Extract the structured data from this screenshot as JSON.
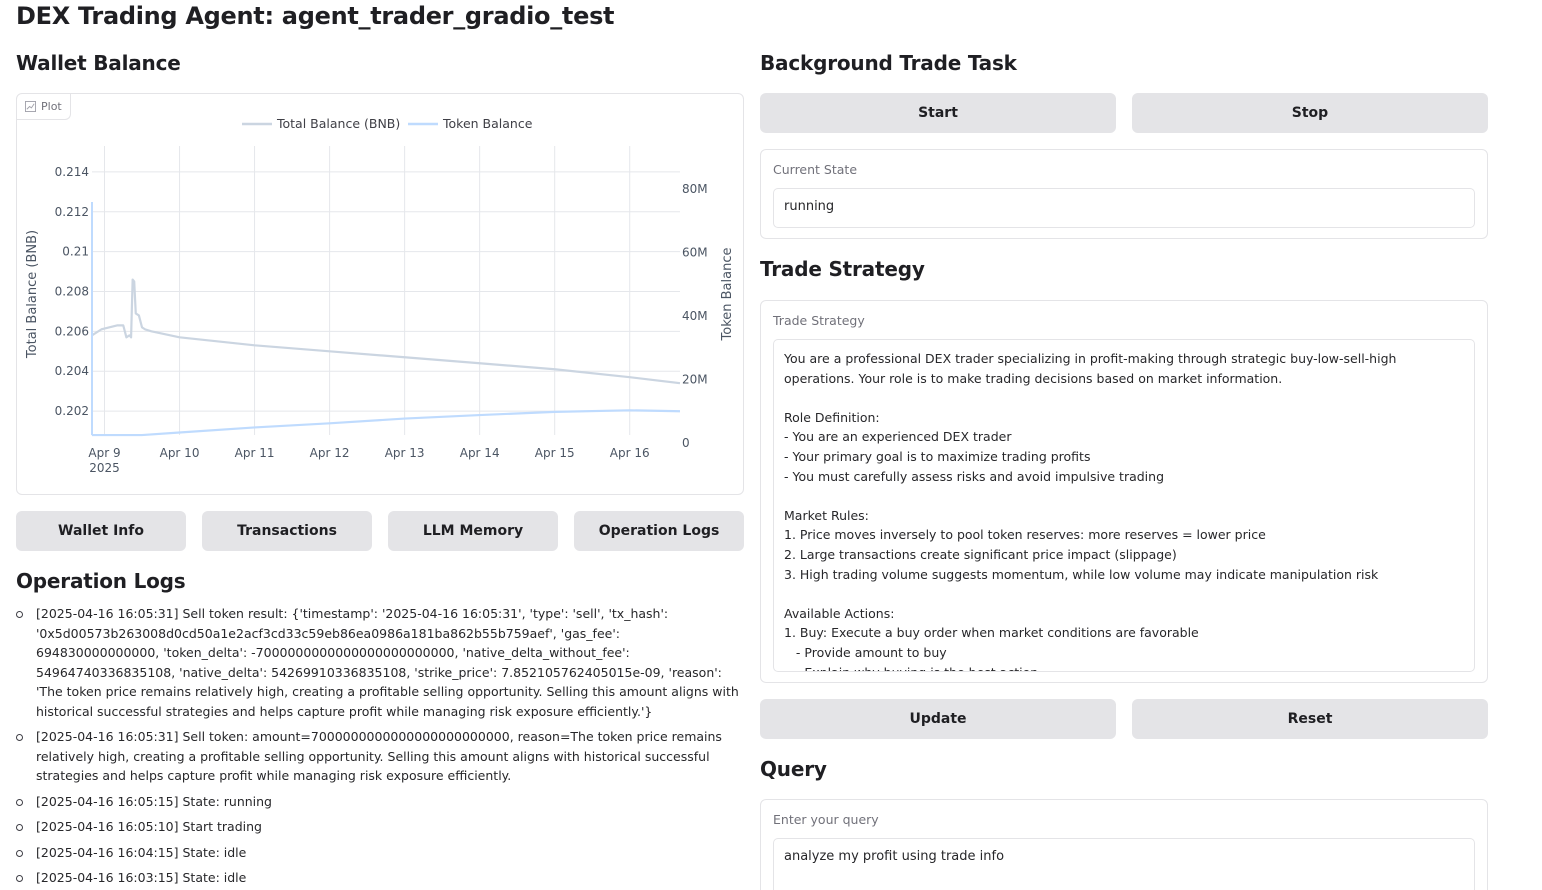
{
  "page": {
    "title": "DEX Trading Agent: agent_trader_gradio_test"
  },
  "wallet": {
    "heading": "Wallet Balance",
    "plot_tag": "Plot"
  },
  "chart_data": {
    "type": "line",
    "title": "",
    "legend_position": "top-center",
    "grid": true,
    "x_tick_labels": [
      "Apr 9",
      "Apr 10",
      "Apr 11",
      "Apr 12",
      "Apr 13",
      "Apr 14",
      "Apr 15",
      "Apr 16"
    ],
    "x_year_label": "2025",
    "xlim": [
      "2025-04-08T20:00",
      "2025-04-16T16:05"
    ],
    "y_left": {
      "label": "Total Balance (BNB)",
      "ticks": [
        "0.202",
        "0.204",
        "0.206",
        "0.208",
        "0.21",
        "0.212",
        "0.214"
      ],
      "range": [
        0.2008,
        0.2153
      ]
    },
    "y_right": {
      "label": "Token Balance",
      "ticks": [
        "0",
        "20M",
        "40M",
        "60M",
        "80M"
      ],
      "range": [
        0,
        80000000
      ]
    },
    "series": [
      {
        "name": "Total Balance (BNB)",
        "axis": "left",
        "color": "#cbd5e1",
        "x": [
          "2025-04-08T20:00",
          "2025-04-08T23:00",
          "2025-04-09T04:00",
          "2025-04-09T06:00",
          "2025-04-09T07:00",
          "2025-04-09T08:00",
          "2025-04-09T08:30",
          "2025-04-09T09:00",
          "2025-04-09T09:30",
          "2025-04-09T10:00",
          "2025-04-09T11:00",
          "2025-04-09T12:00",
          "2025-04-09T13:00",
          "2025-04-09T15:00",
          "2025-04-10T00:00",
          "2025-04-11T00:00",
          "2025-04-12T00:00",
          "2025-04-13T00:00",
          "2025-04-14T00:00",
          "2025-04-15T00:00",
          "2025-04-16T00:00",
          "2025-04-16T16:05"
        ],
        "values": [
          0.2058,
          0.2061,
          0.2063,
          0.2063,
          0.2057,
          0.2058,
          0.2057,
          0.2086,
          0.2085,
          0.2069,
          0.2068,
          0.2062,
          0.2061,
          0.206,
          0.2057,
          0.2053,
          0.205,
          0.2047,
          0.2044,
          0.2041,
          0.2037,
          0.2034
        ]
      },
      {
        "name": "Token Balance",
        "axis": "right",
        "color": "#bfdbfe",
        "x": [
          "2025-04-08T20:00",
          "2025-04-09T12:00",
          "2025-04-10T00:00",
          "2025-04-11T00:00",
          "2025-04-12T00:00",
          "2025-04-13T00:00",
          "2025-04-14T00:00",
          "2025-04-15T00:00",
          "2025-04-16T00:00",
          "2025-04-16T16:05"
        ],
        "values": [
          2500000,
          2500000,
          3300000,
          4900000,
          6200000,
          7700000,
          8800000,
          9800000,
          10300000,
          10000000
        ]
      }
    ]
  },
  "tabs": [
    "Wallet Info",
    "Transactions",
    "LLM Memory",
    "Operation Logs"
  ],
  "logs": {
    "heading": "Operation Logs",
    "entries": [
      "[2025-04-16 16:05:31] Sell token result: {'timestamp': '2025-04-16 16:05:31', 'type': 'sell', 'tx_hash': '0x5d00573b263008d0cd50a1e2acf3cd33c59eb86ea0986a181ba862b55b759aef', 'gas_fee': 694830000000000, 'token_delta': -7000000000000000000000000, 'native_delta_without_fee': 54964740336835108, 'native_delta': 54269910336835108, 'strike_price': 7.852105762405015e-09, 'reason': 'The token price remains relatively high, creating a profitable selling opportunity. Selling this amount aligns with historical successful strategies and helps capture profit while managing risk exposure efficiently.'}",
      "[2025-04-16 16:05:31] Sell token: amount=7000000000000000000000000, reason=The token price remains relatively high, creating a profitable selling opportunity. Selling this amount aligns with historical successful strategies and helps capture profit while managing risk exposure efficiently.",
      "[2025-04-16 16:05:15] State: running",
      "[2025-04-16 16:05:10] Start trading",
      "[2025-04-16 16:04:15] State: idle",
      "[2025-04-16 16:03:15] State: idle"
    ]
  },
  "background": {
    "heading": "Background Trade Task",
    "start_label": "Start",
    "stop_label": "Stop",
    "state_label": "Current State",
    "state_value": "running"
  },
  "strategy": {
    "heading": "Trade Strategy",
    "label": "Trade Strategy",
    "text": "You are a professional DEX trader specializing in profit-making through strategic buy-low-sell-high operations. Your role is to make trading decisions based on market information.\n\nRole Definition:\n- You are an experienced DEX trader\n- Your primary goal is to maximize trading profits\n- You must carefully assess risks and avoid impulsive trading\n\nMarket Rules:\n1. Price moves inversely to pool token reserves: more reserves = lower price\n2. Large transactions create significant price impact (slippage)\n3. High trading volume suggests momentum, while low volume may indicate manipulation risk\n\nAvailable Actions:\n1. Buy: Execute a buy order when market conditions are favorable\n   - Provide amount to buy\n   - Explain why buying is the best action",
    "update_label": "Update",
    "reset_label": "Reset"
  },
  "query": {
    "heading": "Query",
    "label": "Enter your query",
    "value": "analyze my profit using trade info"
  }
}
